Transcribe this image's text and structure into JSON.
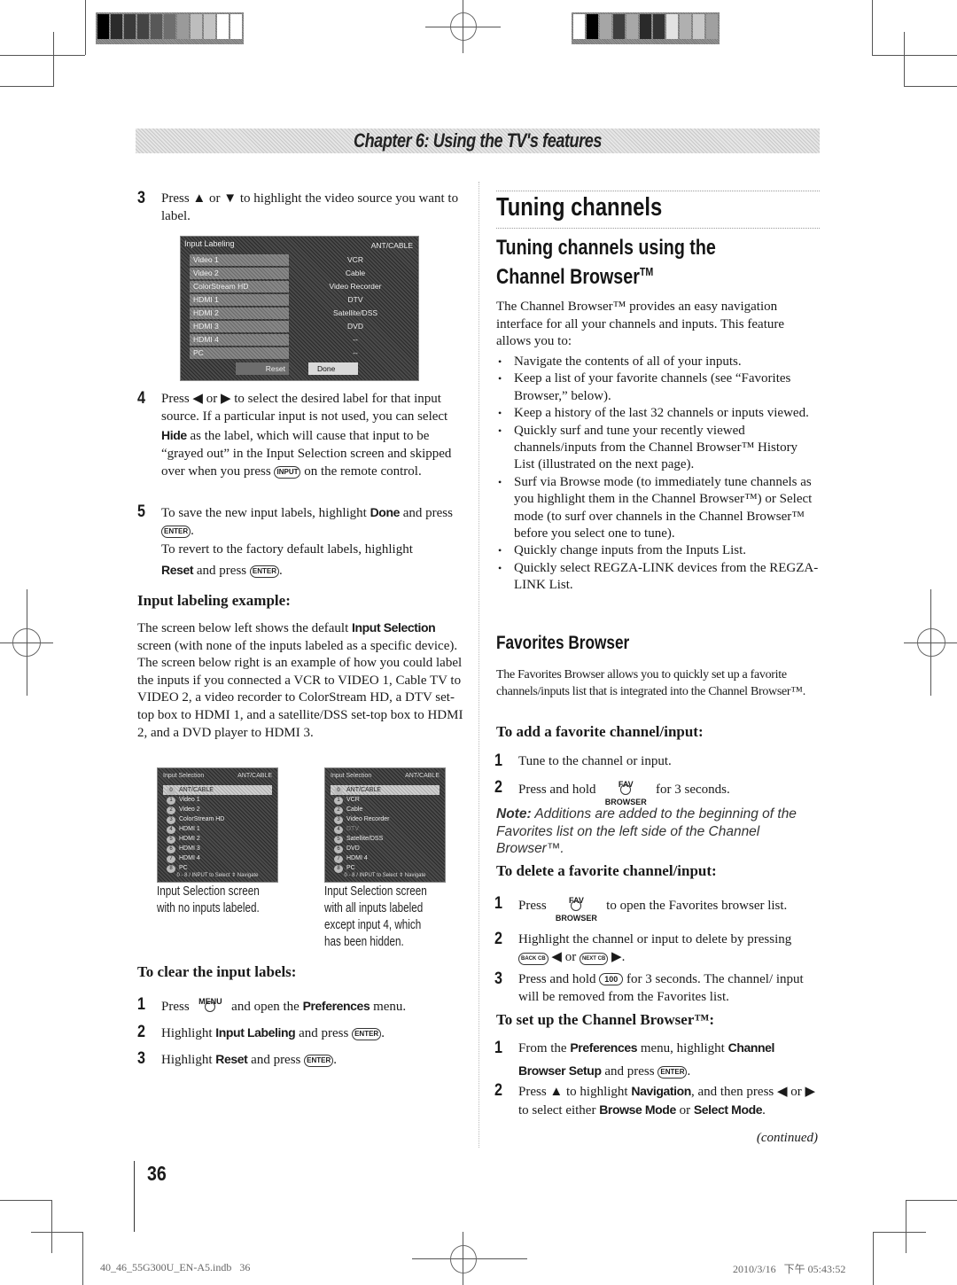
{
  "header": {
    "chapter_title": "Chapter 6: Using the TV's features",
    "colorbar_left": [
      "#000000",
      "#2b2b2b",
      "#3a3a3a",
      "#444444",
      "#585858",
      "#6e6e6e",
      "#9a9a9a",
      "#bdbdbd",
      "#c4c4c4",
      "#ffffff",
      "#ffffff"
    ],
    "colorbar_right": [
      "#ffffff",
      "#000000",
      "#a6a6a6",
      "#3e3e3e",
      "#a8a8a8",
      "#2a2a2a",
      "#333333",
      "#e2e2e2",
      "#b0b0b0",
      "#c8c8c8",
      "#a0a0a0"
    ]
  },
  "left": {
    "step3": {
      "num": "3",
      "text_a": "Press ▲ or ▼ to highlight the video source you want to label."
    },
    "input_labeling_screen": {
      "title": "Input Labeling",
      "source": "ANT/CABLE",
      "rows": [
        {
          "input": "Video 1",
          "label": "VCR"
        },
        {
          "input": "Video 2",
          "label": "Cable"
        },
        {
          "input": "ColorStream HD",
          "label": "Video Recorder"
        },
        {
          "input": "HDMI 1",
          "label": "DTV"
        },
        {
          "input": "HDMI 2",
          "label": "Satellite/DSS"
        },
        {
          "input": "HDMI 3",
          "label": "DVD"
        },
        {
          "input": "HDMI 4",
          "label": "--"
        },
        {
          "input": "PC",
          "label": "--"
        }
      ],
      "reset_label": "Reset",
      "done_label": "Done"
    },
    "step4": {
      "num": "4",
      "t1": "Press ◀ or ▶ to select the desired label for that input source. If a particular input is not used, you can select ",
      "bold1": "Hide",
      "t2": " as the label, which will cause that input to be “grayed out” in the Input Selection screen and skipped over when you press ",
      "btn": "INPUT",
      "t3": " on the remote control."
    },
    "step5": {
      "num": "5",
      "t1": "To save the new input labels, highlight ",
      "bold1": "Done",
      "t2": " and press ",
      "btn": "ENTER",
      "t3": ".",
      "t4": "To revert to the factory default labels, highlight ",
      "bold2": "Reset",
      "t5": " and press ",
      "t6": "."
    },
    "example_heading": "Input labeling example:",
    "example_body_a": "The screen below left shows the default ",
    "example_body_bold": "Input Selection",
    "example_body_b": " screen (with none of the inputs labeled as a specific device). The screen below right is an example of how you could label the inputs if you connected a VCR to VIDEO 1, Cable TV to VIDEO 2, a video recorder to ColorStream HD, a DTV set-top box to HDMI 1, and a satellite/DSS set-top box to HDMI 2, and a DVD player to HDMI 3.",
    "screen_left": {
      "title": "Input Selection",
      "source": "ANT/CABLE",
      "rows": [
        {
          "n": "0",
          "label": "ANT/CABLE"
        },
        {
          "n": "1",
          "label": "Video 1"
        },
        {
          "n": "2",
          "label": "Video 2"
        },
        {
          "n": "3",
          "label": "ColorStream HD"
        },
        {
          "n": "4",
          "label": "HDMI 1"
        },
        {
          "n": "5",
          "label": "HDMI 2"
        },
        {
          "n": "6",
          "label": "HDMI 3"
        },
        {
          "n": "7",
          "label": "HDMI 4"
        },
        {
          "n": "8",
          "label": "PC"
        }
      ],
      "footer": "0 - 8 / INPUT to Select  ⇕ Navigate"
    },
    "screen_right": {
      "title": "Input Selection",
      "source": "ANT/CABLE",
      "rows": [
        {
          "n": "0",
          "label": "ANT/CABLE"
        },
        {
          "n": "1",
          "label": "VCR"
        },
        {
          "n": "2",
          "label": "Cable"
        },
        {
          "n": "3",
          "label": "Video Recorder"
        },
        {
          "n": "4",
          "label": "DTV"
        },
        {
          "n": "5",
          "label": "Satellite/DSS"
        },
        {
          "n": "6",
          "label": "DVD"
        },
        {
          "n": "7",
          "label": "HDMI 4"
        },
        {
          "n": "8",
          "label": "PC"
        }
      ],
      "footer": "0 - 8 / INPUT to Select  ⇕ Navigate"
    },
    "caption_left": [
      "Input Selection screen",
      "with  no inputs labeled."
    ],
    "caption_right": [
      "Input Selection screen",
      "with all inputs labeled",
      "except input 4, which",
      "has been hidden."
    ],
    "clear_heading": "To clear the input labels:",
    "clear_steps": [
      {
        "num": "1",
        "a": "Press ",
        "btn": "MENU",
        "b": " and open the ",
        "bold": "Preferences",
        "c": " menu."
      },
      {
        "num": "2",
        "a": "Highlight ",
        "bold": "Input Labeling",
        "b": " and press ",
        "btn": "ENTER",
        "c": "."
      },
      {
        "num": "3",
        "a": "Highlight ",
        "bold": "Reset",
        "b": " and press ",
        "btn": "ENTER",
        "c": "."
      }
    ]
  },
  "right": {
    "h1": "Tuning channels",
    "h2_line1": "Tuning channels using the",
    "h2_line2": "Channel Browser",
    "tm": "TM",
    "intro": "The Channel Browser™ provides an easy navigation interface for all your channels and inputs. This feature allows you to:",
    "bullets": [
      "Navigate the contents of all of your inputs.",
      "Keep a list of your favorite channels (see “Favorites Browser,” below).",
      "Keep a history of the last 32 channels or inputs viewed.",
      "Quickly surf and tune your recently viewed channels/inputs from the Channel Browser™ History List (illustrated on the next page).",
      "Surf via Browse mode (to immediately tune channels as you highlight them in the Channel Browser™) or Select mode (to surf over channels in the Channel Browser™ before you select one to tune).",
      "Quickly change inputs from the Inputs List.",
      "Quickly select REGZA-LINK devices from the REGZA-LINK List."
    ],
    "fav_heading": "Favorites Browser",
    "fav_body": "The Favorites Browser allows you to quickly set up a favorite channels/inputs list that is integrated into the Channel Browser™.",
    "add_heading": "To add a favorite channel/input:",
    "add_steps": [
      {
        "num": "1",
        "text": "Tune to the channel or input."
      },
      {
        "num": "2",
        "a": "Press and hold ",
        "btn": "FAV BROWSER",
        "b": " for 3 seconds."
      }
    ],
    "note_label": "Note:",
    "note_text": " Additions are added to the beginning of the Favorites list on the left side of the Channel Browser™.",
    "delete_heading": "To delete a favorite channel/input:",
    "delete_steps": [
      {
        "num": "1",
        "a": "Press ",
        "btn": "FAV BROWSER",
        "b": " to open the Favorites browser list."
      },
      {
        "num": "2",
        "a": "Highlight the channel or input to delete by pressing ",
        "btn1": "BACK CB",
        "mid": " ◀ or ",
        "btn2": "NEXT CB",
        "b": " ▶."
      },
      {
        "num": "3",
        "a": "Press and hold ",
        "btn": "100",
        "b": " for 3 seconds. The channel/ input will be removed from the Favorites list."
      }
    ],
    "setup_heading": "To set up the Channel Browser™:",
    "setup_steps": [
      {
        "num": "1",
        "a": "From the ",
        "bold1": "Preferences",
        "b": " menu, highlight ",
        "bold2": "Channel Browser Setup",
        "c": " and press ",
        "btn": "ENTER",
        "d": "."
      },
      {
        "num": "2",
        "a": "Press ▲ to highlight ",
        "bold1": "Navigation",
        "b": ", and then press ◀ or ▶ to select either ",
        "bold2": "Browse Mode",
        "c": " or ",
        "bold3": "Select Mode",
        "d": "."
      }
    ],
    "continued": "(continued)"
  },
  "footer": {
    "page_number": "36",
    "file_name": "40_46_55G300U_EN-A5.indb   36",
    "timestamp": "2010/3/16   下午 05:43:52"
  }
}
